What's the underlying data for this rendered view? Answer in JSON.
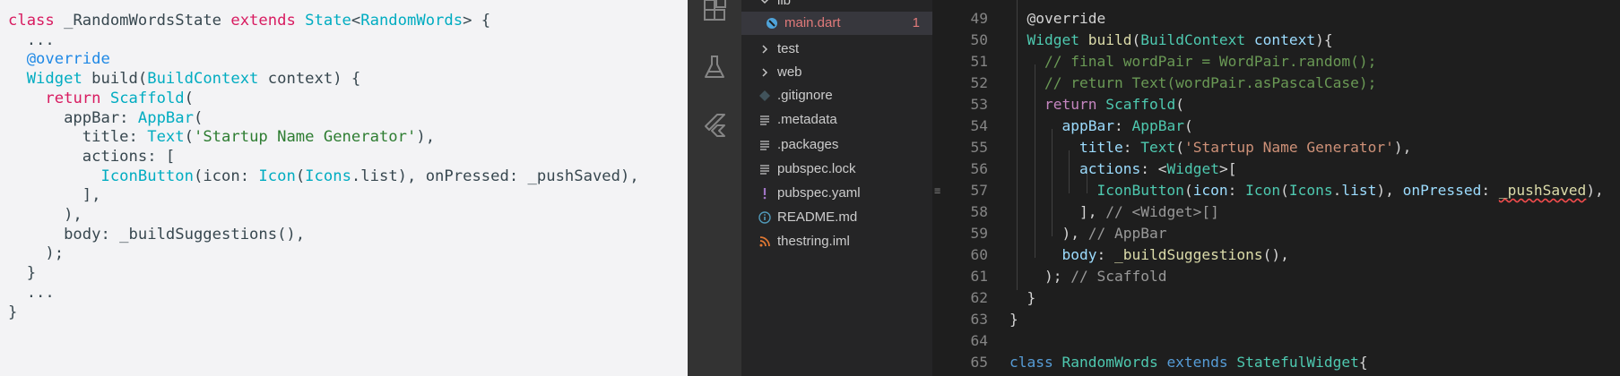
{
  "colors": {
    "snippet_bg": "#f3f3f5",
    "activity_bg": "#333333",
    "explorer_bg": "#252526",
    "editor_bg": "#1e1e1e",
    "error": "#e07a7a"
  },
  "snippet": {
    "lines": [
      [
        {
          "t": "class",
          "c": "kw"
        },
        {
          "t": " _RandomWordsState ",
          "c": "pl"
        },
        {
          "t": "extends",
          "c": "kw"
        },
        {
          "t": " ",
          "c": "pl"
        },
        {
          "t": "State",
          "c": "type"
        },
        {
          "t": "<",
          "c": "pl"
        },
        {
          "t": "RandomWords",
          "c": "type"
        },
        {
          "t": "> {",
          "c": "pl"
        }
      ],
      [
        {
          "t": "  ...",
          "c": "pl"
        }
      ],
      [
        {
          "t": "  @override",
          "c": "anno"
        }
      ],
      [
        {
          "t": "  ",
          "c": "pl"
        },
        {
          "t": "Widget",
          "c": "type"
        },
        {
          "t": " build(",
          "c": "pl"
        },
        {
          "t": "BuildContext",
          "c": "type"
        },
        {
          "t": " context) {",
          "c": "pl"
        }
      ],
      [
        {
          "t": "    ",
          "c": "pl"
        },
        {
          "t": "return",
          "c": "kw"
        },
        {
          "t": " ",
          "c": "pl"
        },
        {
          "t": "Scaffold",
          "c": "type"
        },
        {
          "t": "(",
          "c": "pl"
        }
      ],
      [
        {
          "t": "      appBar: ",
          "c": "pl"
        },
        {
          "t": "AppBar",
          "c": "type"
        },
        {
          "t": "(",
          "c": "pl"
        }
      ],
      [
        {
          "t": "        title: ",
          "c": "pl"
        },
        {
          "t": "Text",
          "c": "type"
        },
        {
          "t": "(",
          "c": "pl"
        },
        {
          "t": "'Startup Name Generator'",
          "c": "str"
        },
        {
          "t": "),",
          "c": "pl"
        }
      ],
      [
        {
          "t": "        actions: [",
          "c": "pl"
        }
      ],
      [
        {
          "t": "          ",
          "c": "pl"
        },
        {
          "t": "IconButton",
          "c": "type"
        },
        {
          "t": "(icon: ",
          "c": "pl"
        },
        {
          "t": "Icon",
          "c": "type"
        },
        {
          "t": "(",
          "c": "pl"
        },
        {
          "t": "Icons",
          "c": "type"
        },
        {
          "t": ".list), onPressed: _pushSaved),",
          "c": "pl"
        }
      ],
      [
        {
          "t": "        ],",
          "c": "pl"
        }
      ],
      [
        {
          "t": "      ),",
          "c": "pl"
        }
      ],
      [
        {
          "t": "      body: _buildSuggestions(),",
          "c": "pl"
        }
      ],
      [
        {
          "t": "    );",
          "c": "pl"
        }
      ],
      [
        {
          "t": "  }",
          "c": "pl"
        }
      ],
      [
        {
          "t": "  ...",
          "c": "pl"
        }
      ],
      [
        {
          "t": "}",
          "c": "pl"
        }
      ]
    ]
  },
  "activity_bar": {
    "icons": [
      "extensions-icon",
      "testing-flask-icon",
      "flutter-icon"
    ]
  },
  "explorer": {
    "items": [
      {
        "label": "lib",
        "icon": "chevron-down-icon",
        "depth": 0,
        "active": false
      },
      {
        "label": "main.dart",
        "icon": "dart-file-icon",
        "depth": 1,
        "active": true,
        "badge": "1"
      },
      {
        "label": "test",
        "icon": "chevron-right-icon",
        "depth": 0,
        "active": false
      },
      {
        "label": "web",
        "icon": "chevron-right-icon",
        "depth": 0,
        "active": false
      },
      {
        "label": ".gitignore",
        "icon": "git-diamond-icon",
        "depth": 0,
        "active": false
      },
      {
        "label": ".metadata",
        "icon": "lines-file-icon",
        "depth": 0,
        "active": false
      },
      {
        "label": ".packages",
        "icon": "lines-file-icon",
        "depth": 0,
        "active": false
      },
      {
        "label": "pubspec.lock",
        "icon": "lines-file-icon",
        "depth": 0,
        "active": false
      },
      {
        "label": "pubspec.yaml",
        "icon": "exclamation-file-icon",
        "depth": 0,
        "active": false
      },
      {
        "label": "README.md",
        "icon": "info-file-icon",
        "depth": 0,
        "active": false
      },
      {
        "label": "thestring.iml",
        "icon": "rss-file-icon",
        "depth": 0,
        "active": false
      }
    ]
  },
  "editor": {
    "lines": [
      {
        "n": "49",
        "tokens": [
          {
            "t": "@override",
            "c": "ann"
          }
        ]
      },
      {
        "n": "50",
        "tokens": [
          {
            "t": "Widget",
            "c": "type"
          },
          {
            "t": " ",
            "c": "pl"
          },
          {
            "t": "build",
            "c": "fn"
          },
          {
            "t": "(",
            "c": "pl"
          },
          {
            "t": "BuildContext",
            "c": "type"
          },
          {
            "t": " ",
            "c": "pl"
          },
          {
            "t": "context",
            "c": "var"
          },
          {
            "t": "){",
            "c": "pl"
          }
        ]
      },
      {
        "n": "51",
        "tokens": [
          {
            "t": "  // final wordPair = WordPair.random();",
            "c": "cm"
          }
        ]
      },
      {
        "n": "52",
        "tokens": [
          {
            "t": "  // return Text(wordPair.asPascalCase);",
            "c": "cm"
          }
        ]
      },
      {
        "n": "53",
        "tokens": [
          {
            "t": "  ",
            "c": "pl"
          },
          {
            "t": "return",
            "c": "kw"
          },
          {
            "t": " ",
            "c": "pl"
          },
          {
            "t": "Scaffold",
            "c": "type"
          },
          {
            "t": "(",
            "c": "pl"
          }
        ]
      },
      {
        "n": "54",
        "tokens": [
          {
            "t": "    ",
            "c": "pl"
          },
          {
            "t": "appBar",
            "c": "var"
          },
          {
            "t": ": ",
            "c": "pl"
          },
          {
            "t": "AppBar",
            "c": "type"
          },
          {
            "t": "(",
            "c": "pl"
          }
        ]
      },
      {
        "n": "55",
        "tokens": [
          {
            "t": "      ",
            "c": "pl"
          },
          {
            "t": "title",
            "c": "var"
          },
          {
            "t": ": ",
            "c": "pl"
          },
          {
            "t": "Text",
            "c": "type"
          },
          {
            "t": "(",
            "c": "pl"
          },
          {
            "t": "'Startup Name Generator'",
            "c": "str"
          },
          {
            "t": "),",
            "c": "pl"
          }
        ]
      },
      {
        "n": "56",
        "tokens": [
          {
            "t": "      ",
            "c": "pl"
          },
          {
            "t": "actions",
            "c": "var"
          },
          {
            "t": ": <",
            "c": "pl"
          },
          {
            "t": "Widget",
            "c": "type"
          },
          {
            "t": ">[",
            "c": "pl"
          }
        ]
      },
      {
        "n": "57",
        "tokens": [
          {
            "t": "        ",
            "c": "pl"
          },
          {
            "t": "IconButton",
            "c": "type"
          },
          {
            "t": "(",
            "c": "pl"
          },
          {
            "t": "icon",
            "c": "var"
          },
          {
            "t": ": ",
            "c": "pl"
          },
          {
            "t": "Icon",
            "c": "type"
          },
          {
            "t": "(",
            "c": "pl"
          },
          {
            "t": "Icons",
            "c": "type"
          },
          {
            "t": ".",
            "c": "pl"
          },
          {
            "t": "list",
            "c": "var"
          },
          {
            "t": "), ",
            "c": "pl"
          },
          {
            "t": "onPressed",
            "c": "var"
          },
          {
            "t": ": ",
            "c": "pl"
          },
          {
            "t": "_pushSaved",
            "c": "fn",
            "squig": true
          },
          {
            "t": "),",
            "c": "pl"
          }
        ]
      },
      {
        "n": "58",
        "tokens": [
          {
            "t": "      ], ",
            "c": "pl"
          },
          {
            "t": "// <Widget>[]",
            "c": "cmgray"
          }
        ]
      },
      {
        "n": "59",
        "tokens": [
          {
            "t": "    ), ",
            "c": "pl"
          },
          {
            "t": "// AppBar",
            "c": "cmgray"
          }
        ]
      },
      {
        "n": "60",
        "tokens": [
          {
            "t": "    ",
            "c": "pl"
          },
          {
            "t": "body",
            "c": "var"
          },
          {
            "t": ": ",
            "c": "pl"
          },
          {
            "t": "_buildSuggestions",
            "c": "fn"
          },
          {
            "t": "(),",
            "c": "pl"
          }
        ]
      },
      {
        "n": "61",
        "tokens": [
          {
            "t": "  ); ",
            "c": "pl"
          },
          {
            "t": "// Scaffold",
            "c": "cmgray"
          }
        ]
      },
      {
        "n": "62",
        "tokens": [
          {
            "t": "}",
            "c": "pl"
          }
        ]
      },
      {
        "n": "63",
        "tokens": [
          {
            "t": "}",
            "c": "pl"
          }
        ]
      },
      {
        "n": "64",
        "tokens": []
      },
      {
        "n": "65",
        "tokens": [
          {
            "t": "class",
            "c": "bl"
          },
          {
            "t": " ",
            "c": "pl"
          },
          {
            "t": "RandomWords",
            "c": "type"
          },
          {
            "t": " ",
            "c": "pl"
          },
          {
            "t": "extends",
            "c": "bl"
          },
          {
            "t": " ",
            "c": "pl"
          },
          {
            "t": "StatefulWidget",
            "c": "type"
          },
          {
            "t": "{",
            "c": "pl"
          }
        ]
      }
    ]
  }
}
